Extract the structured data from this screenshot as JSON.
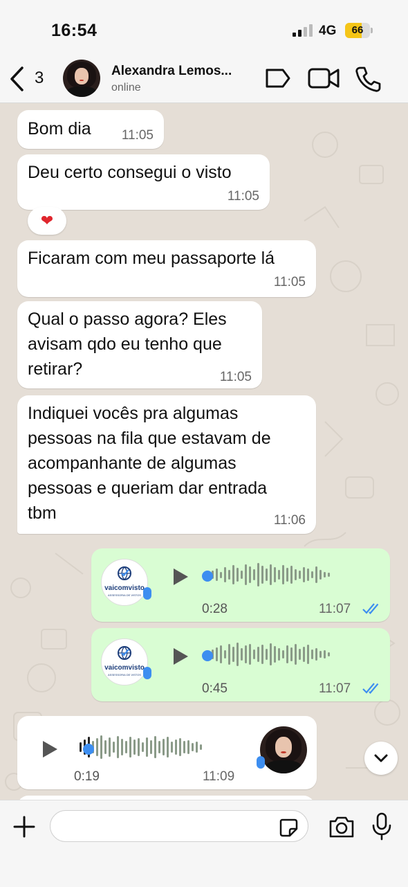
{
  "status_bar": {
    "time": "16:54",
    "network": "4G",
    "battery": "66",
    "battery_level_percent": 66
  },
  "header": {
    "back_count": "3",
    "contact_name": "Alexandra Lemos...",
    "contact_status": "online",
    "icons": [
      "chevron-left-icon",
      "label-tag-icon",
      "video-call-icon",
      "phone-icon"
    ]
  },
  "messages": [
    {
      "dir": "in",
      "lines": [
        "Bom dia"
      ],
      "time": "11:05"
    },
    {
      "dir": "in",
      "lines": [
        "Deu certo consegui o visto"
      ],
      "time": "11:05",
      "reaction": "❤"
    },
    {
      "dir": "in",
      "lines": [
        "Ficaram com meu passaporte lá"
      ],
      "time": "11:05"
    },
    {
      "dir": "in",
      "lines": [
        "Qual o passo agora? Eles",
        "avisam qdo eu tenho que",
        "retirar?"
      ],
      "time": "11:05"
    },
    {
      "dir": "in",
      "lines": [
        "Indiquei vocês pra algumas",
        "pessoas na fila que estavam de",
        "acompanhante de algumas",
        "pessoas e queriam dar entrada",
        "tbm"
      ],
      "time": "11:06"
    }
  ],
  "voice_notes": [
    {
      "dir": "out",
      "duration": "0:28",
      "time": "11:07",
      "status": "read",
      "logo_text": "vaicomvisto",
      "logo_subtext": "ASSESSORIA DE VISTOS",
      "progress": 0
    },
    {
      "dir": "out",
      "duration": "0:45",
      "time": "11:07",
      "status": "read",
      "logo_text": "vaicomvisto",
      "logo_subtext": "ASSESSORIA DE VISTOS",
      "progress": 0
    },
    {
      "dir": "in",
      "duration": "0:19",
      "time": "11:09",
      "status": "received",
      "progress": 0.07
    }
  ],
  "input_bar": {
    "placeholder": "",
    "icons": [
      "plus-icon",
      "sticker-icon",
      "camera-icon",
      "microphone-icon"
    ]
  },
  "colors": {
    "outgoing_bubble": "#d9fdd3",
    "incoming_bubble": "#ffffff",
    "chat_background": "#e5ded6",
    "accent_blue": "#3d8ef0",
    "battery_yellow": "#f5c518"
  }
}
